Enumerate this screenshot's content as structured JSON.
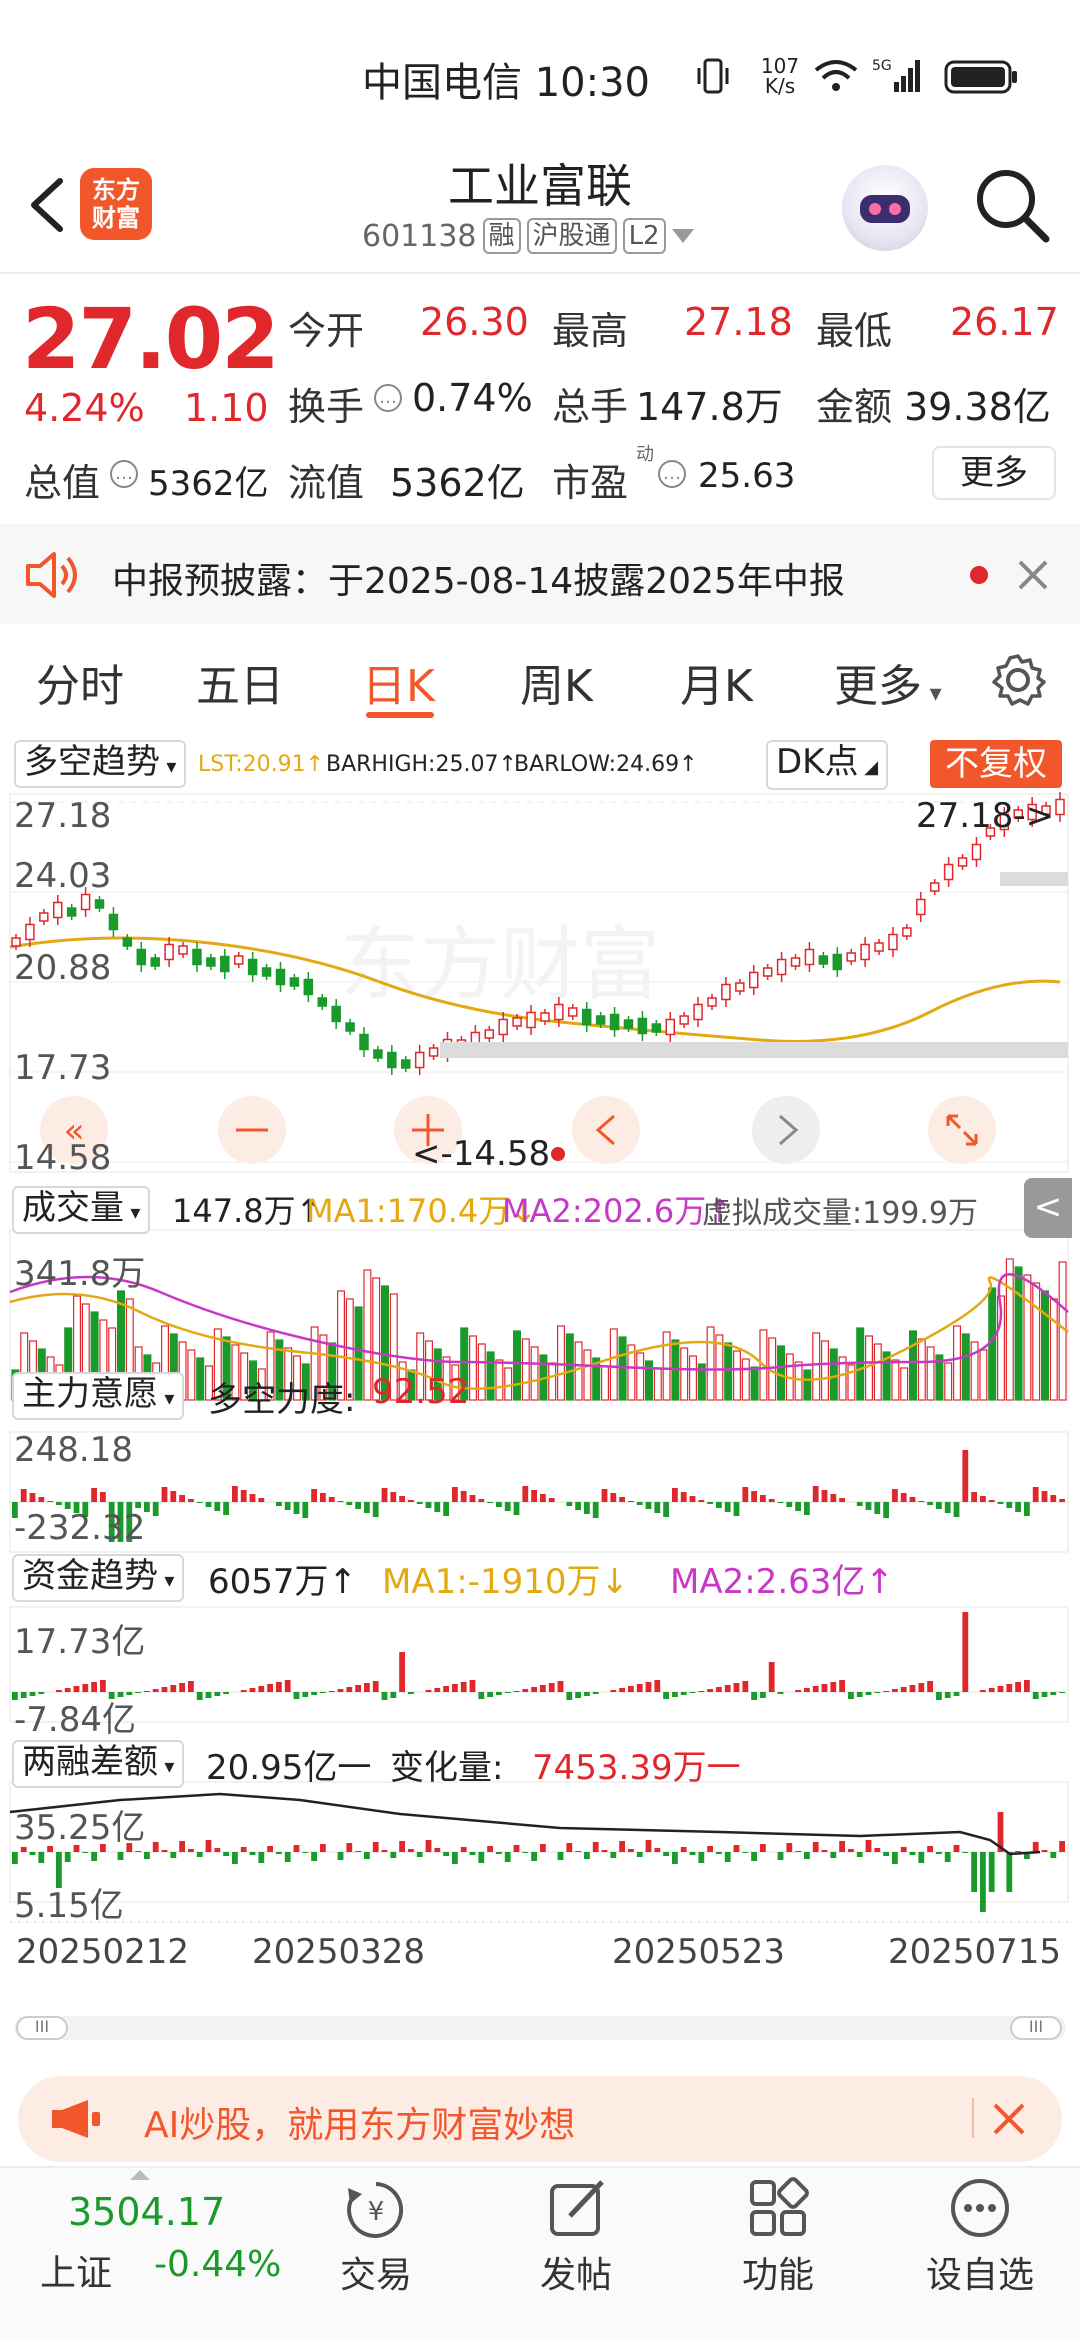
{
  "status_bar": {
    "carrier_time": "中国电信 10:30",
    "net_speed_top": "107",
    "net_speed_unit": "K/s"
  },
  "header": {
    "logo_line1": "东方",
    "logo_line2": "财富",
    "title": "工业富联",
    "code": "601138",
    "tag1": "融",
    "tag2": "沪股通",
    "tag3": "L2"
  },
  "quote": {
    "price": "27.02",
    "pct": "4.24%",
    "change": "1.10",
    "open_label": "今开",
    "open": "26.30",
    "high_label": "最高",
    "high": "27.18",
    "low_label": "最低",
    "low": "26.17",
    "turnover_label": "换手",
    "turnover": "0.74%",
    "volume_label": "总手",
    "volume": "147.8万",
    "amount_label": "金额",
    "amount": "39.38亿",
    "mktcap_label": "总值",
    "mktcap": "5362亿",
    "float_label": "流值",
    "float": "5362亿",
    "pe_label": "市盈",
    "pe_sup": "动",
    "pe": "25.63",
    "more": "更多"
  },
  "notice": {
    "text": "中报预披露：于2025-08-14披露2025年中报"
  },
  "tabs": [
    "分时",
    "五日",
    "日K",
    "周K",
    "月K",
    "更多"
  ],
  "active_tab": 2,
  "chart": {
    "indicator_select": "多空趋势",
    "lst": "LST:20.91↑",
    "barhigh": "BARHIGH:25.07↑",
    "barlow": "BARLOW:24.69↑",
    "dk_select": "DK点",
    "fq_button": "不复权",
    "y_labels": [
      "27.18",
      "24.03",
      "20.88",
      "17.73",
      "14.58"
    ],
    "max_marker": "27.18->",
    "min_marker": "<-14.58",
    "volume_select": "成交量",
    "volume_now": "147.8万↑",
    "vol_ma1": "MA1:170.4万↓",
    "vol_ma2": "MA2:202.6万↑",
    "vol_virtual": "虚拟成交量:199.9万",
    "vol_top": "341.8万",
    "force_select": "主力意愿",
    "force_label": "多空力度:",
    "force_value": "92.52",
    "force_top": "248.18",
    "force_bottom": "-232.32",
    "fund_select": "资金趋势",
    "fund_value": "6057万↑",
    "fund_ma1": "MA1:-1910万↓",
    "fund_ma2": "MA2:2.63亿↑",
    "fund_top": "17.73亿",
    "fund_bottom": "-7.84亿",
    "margin_select": "两融差额",
    "margin_value": "20.95亿一",
    "margin_change_label": "变化量:",
    "margin_change": "7453.39万一",
    "margin_top": "35.25亿",
    "margin_bottom": "5.15亿",
    "dates": [
      "20250212",
      "20250328",
      "20250523",
      "20250715"
    ],
    "collapse_arrow": "<"
  },
  "chart_data": {
    "type": "candlestick",
    "title": "",
    "y_range": [
      14.58,
      27.18
    ],
    "ticks": [
      "27.18",
      "24.03",
      "20.88",
      "17.73",
      "14.58"
    ],
    "x_ticks": [
      "20250212",
      "20250328",
      "20250523",
      "20250715"
    ],
    "high": 27.18,
    "low": 14.58
  },
  "ai_banner": {
    "text": "AI炒股，就用东方财富妙想"
  },
  "bottom_nav": {
    "index_value": "3504.17",
    "index_name": "上证",
    "index_change": "-0.44%",
    "items": [
      "交易",
      "发帖",
      "功能",
      "设自选"
    ]
  },
  "colors": {
    "accent": "#f2572b",
    "up": "#e0272b",
    "down": "#1a9a2a",
    "ma_yellow": "#e4a912",
    "ma_magenta": "#c738c7"
  }
}
